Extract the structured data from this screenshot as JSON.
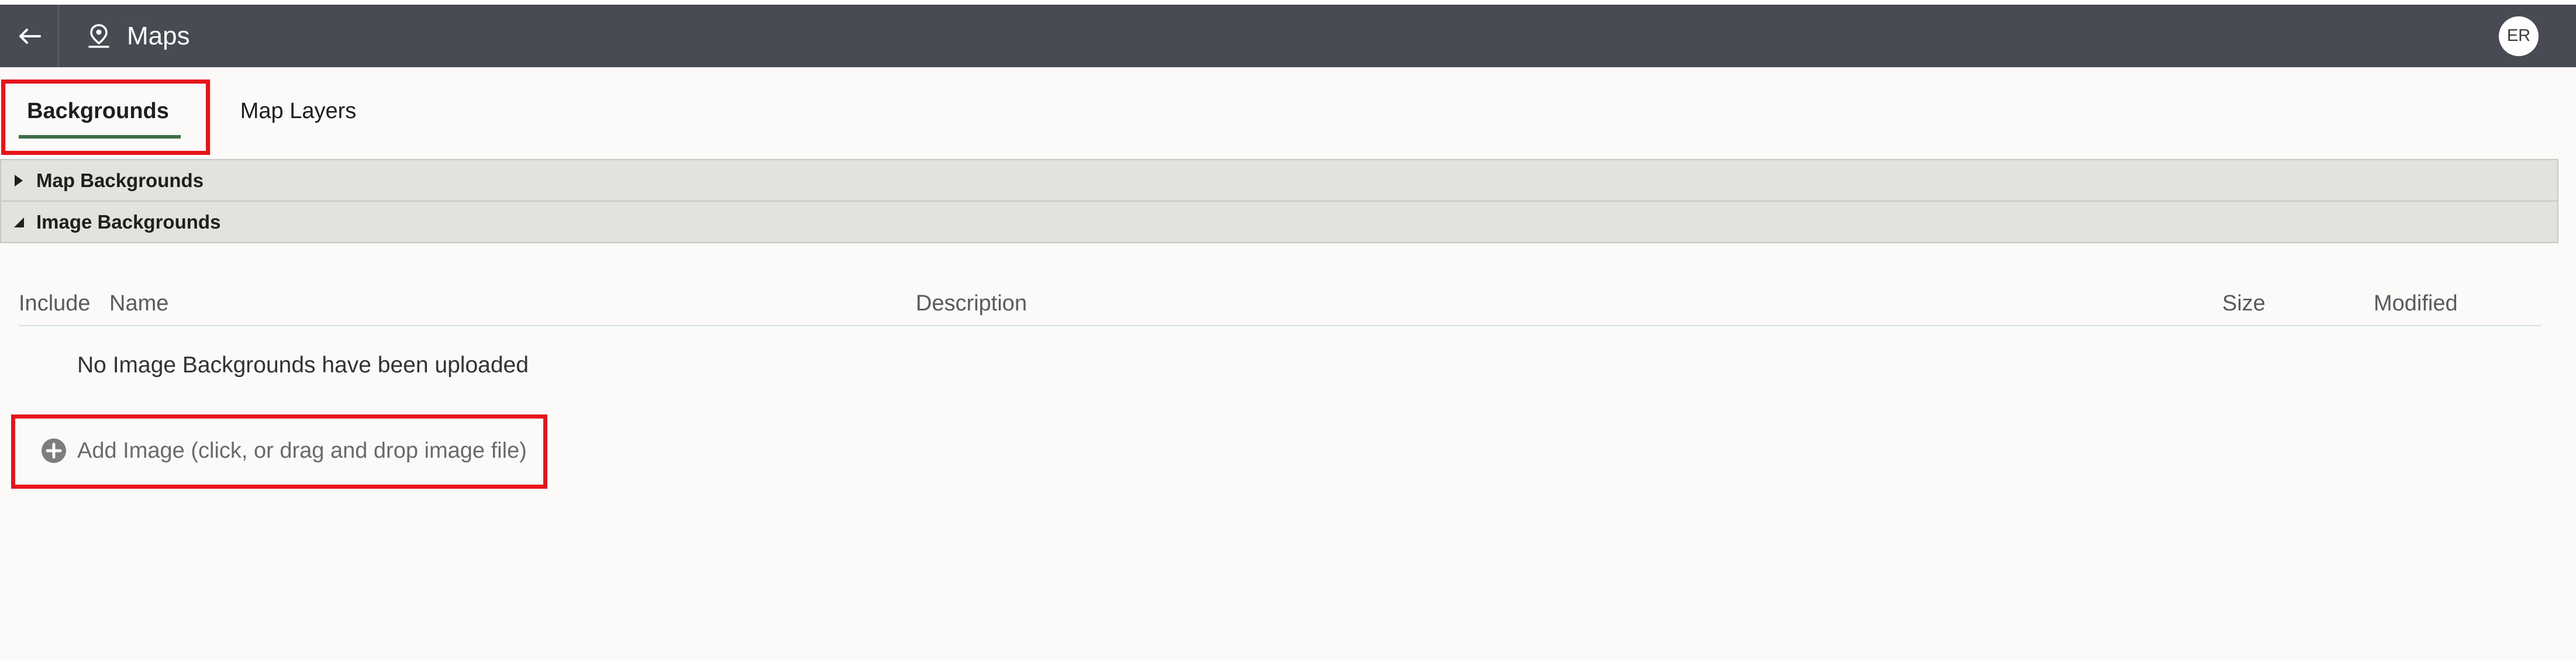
{
  "header": {
    "title": "Maps",
    "user_initials": "ER",
    "back_icon": "back-arrow-icon",
    "app_icon": "map-pin-icon"
  },
  "tabs": [
    {
      "label": "Backgrounds",
      "selected": true
    },
    {
      "label": "Map Layers",
      "selected": false
    }
  ],
  "sections": {
    "map_backgrounds": {
      "label": "Map Backgrounds",
      "expanded": false
    },
    "image_backgrounds": {
      "label": "Image Backgrounds",
      "expanded": true
    }
  },
  "table": {
    "columns": [
      "Include",
      "Name",
      "Description",
      "Size",
      "Modified"
    ],
    "empty_message": "No Image Backgrounds have been uploaded"
  },
  "add_image": {
    "label": "Add Image (click, or drag and drop image file)",
    "icon": "add-circle-icon"
  },
  "colors": {
    "header_bg": "#484b53",
    "tab_underline": "#3c6e48",
    "highlight": "#e8141c"
  }
}
